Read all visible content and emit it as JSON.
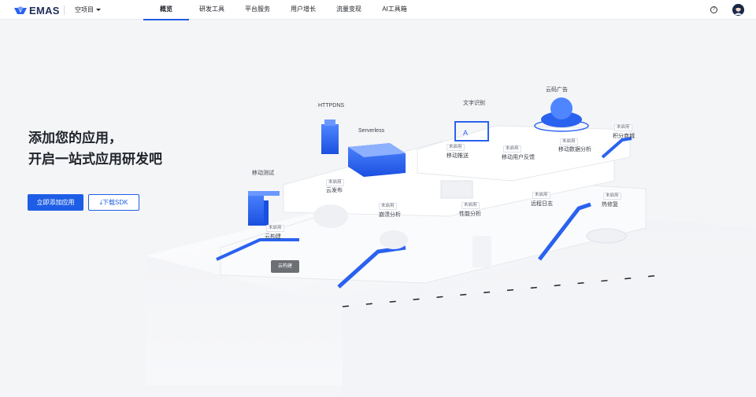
{
  "brand": {
    "name": "EMAS",
    "accent": "#1e5ee6"
  },
  "header": {
    "project": "空项目",
    "tabs": [
      {
        "label": "概览",
        "active": true
      },
      {
        "label": "研发工具",
        "active": false
      },
      {
        "label": "平台服务",
        "active": false
      },
      {
        "label": "用户增长",
        "active": false
      },
      {
        "label": "流量变现",
        "active": false
      },
      {
        "label": "AI工具箱",
        "active": false
      }
    ],
    "help_icon": "question-circle-icon",
    "avatar_icon": "user-avatar-icon"
  },
  "hero": {
    "title_line1": "添加您的应用，",
    "title_line2": "开启一站式应用研发吧",
    "primary_button": "立即添加应用",
    "secondary_button": "下载SDK",
    "download_icon": "download-icon"
  },
  "illustration": {
    "status_text": "未启用",
    "services": [
      {
        "name": "HTTPDNS"
      },
      {
        "name": "Serverless"
      },
      {
        "name": "文字识别"
      },
      {
        "name": "云码广告"
      },
      {
        "name": "移动测试"
      },
      {
        "name": "云发布",
        "status": "未启用"
      },
      {
        "name": "移动推送",
        "status": "未启用"
      },
      {
        "name": "移动用户反馈",
        "status": "未启用"
      },
      {
        "name": "移动数据分析",
        "status": "未启用"
      },
      {
        "name": "积分商城",
        "status": "未启用"
      },
      {
        "name": "云构建",
        "status": "未启用"
      },
      {
        "name": "崩溃分析",
        "status": "未启用"
      },
      {
        "name": "性能分析",
        "status": "未启用"
      },
      {
        "name": "远程日志",
        "status": "未启用"
      },
      {
        "name": "热修复",
        "status": "未启用"
      }
    ],
    "hover_tooltip": "云构建"
  }
}
